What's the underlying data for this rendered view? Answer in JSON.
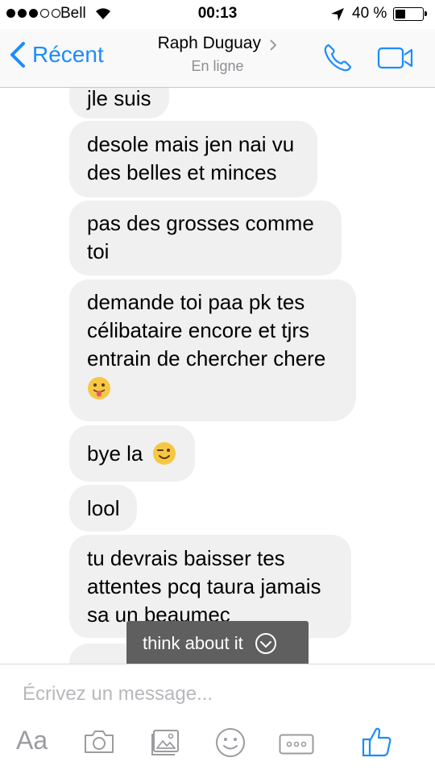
{
  "status_bar": {
    "carrier": "Bell",
    "time": "00:13",
    "battery_pct": "40 %",
    "battery_level": 0.4
  },
  "nav": {
    "back_label": "Récent",
    "contact_name": "Raph Duguay",
    "contact_status": "En ligne"
  },
  "messages": [
    {
      "lines": [
        "jle suis"
      ]
    },
    {
      "lines": [
        "desole mais jen nai vu",
        "des belles et minces"
      ]
    },
    {
      "lines": [
        "pas des grosses comme",
        "toi"
      ]
    },
    {
      "lines": [
        "demande toi paa pk tes",
        "célibataire encore et tjrs",
        "entrain de chercher chere"
      ],
      "emoji": "tongue-out-emoji"
    },
    {
      "lines": [
        "bye la"
      ],
      "emoji": "wink-emoji"
    },
    {
      "lines": [
        "lool"
      ]
    },
    {
      "lines": [
        "tu devrais baisser tes",
        "attentes pcq taura jamais",
        "sa un beaumec"
      ]
    }
  ],
  "toast": {
    "label": "think about it"
  },
  "composer": {
    "placeholder": "Écrivez un message...",
    "value": "",
    "text_tool": "Aa"
  },
  "colors": {
    "accent": "#1a8cff",
    "bubble": "#f1f0f0",
    "toast": "#5f5f5f"
  }
}
